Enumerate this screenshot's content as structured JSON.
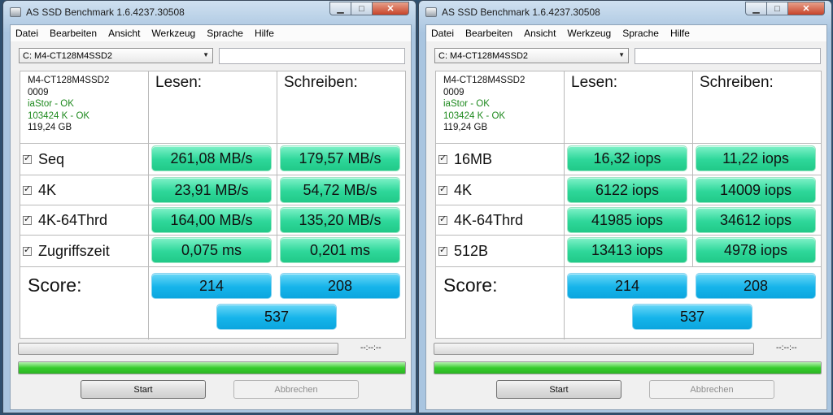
{
  "windows": [
    {
      "title": "AS SSD Benchmark 1.6.4237.30508",
      "menu": [
        "Datei",
        "Bearbeiten",
        "Ansicht",
        "Werkzeug",
        "Sprache",
        "Hilfe"
      ],
      "drive": "C: M4-CT128M4SSD2",
      "info": {
        "model": "M4-CT128M4SSD2",
        "firmware": "0009",
        "driver": "iaStor - OK",
        "alignment": "103424 K - OK",
        "size": "119,24 GB"
      },
      "headers": {
        "read": "Lesen:",
        "write": "Schreiben:"
      },
      "rows": [
        {
          "label": "Seq",
          "read": "261,08 MB/s",
          "write": "179,57 MB/s"
        },
        {
          "label": "4K",
          "read": "23,91 MB/s",
          "write": "54,72 MB/s"
        },
        {
          "label": "4K-64Thrd",
          "read": "164,00 MB/s",
          "write": "135,20 MB/s"
        },
        {
          "label": "Zugriffszeit",
          "read": "0,075 ms",
          "write": "0,201 ms"
        }
      ],
      "score": {
        "label": "Score:",
        "read": "214",
        "write": "208",
        "total": "537"
      },
      "eta": "--:--:--",
      "progress_percent": 100,
      "buttons": {
        "start": "Start",
        "abort": "Abbrechen"
      }
    },
    {
      "title": "AS SSD Benchmark 1.6.4237.30508",
      "menu": [
        "Datei",
        "Bearbeiten",
        "Ansicht",
        "Werkzeug",
        "Sprache",
        "Hilfe"
      ],
      "drive": "C: M4-CT128M4SSD2",
      "info": {
        "model": "M4-CT128M4SSD2",
        "firmware": "0009",
        "driver": "iaStor - OK",
        "alignment": "103424 K - OK",
        "size": "119,24 GB"
      },
      "headers": {
        "read": "Lesen:",
        "write": "Schreiben:"
      },
      "rows": [
        {
          "label": "16MB",
          "read": "16,32 iops",
          "write": "11,22 iops"
        },
        {
          "label": "4K",
          "read": "6122 iops",
          "write": "14009 iops"
        },
        {
          "label": "4K-64Thrd",
          "read": "41985 iops",
          "write": "34612 iops"
        },
        {
          "label": "512B",
          "read": "13413 iops",
          "write": "4978 iops"
        }
      ],
      "score": {
        "label": "Score:",
        "read": "214",
        "write": "208",
        "total": "537"
      },
      "eta": "--:--:--",
      "progress_percent": 100,
      "buttons": {
        "start": "Start",
        "abort": "Abbrechen"
      }
    }
  ],
  "colors": {
    "value_cell": "#2ed79a",
    "score_cell": "#15b4ea",
    "progress_fill": "#35cc2c",
    "ok_text": "#1f8a1f"
  },
  "icons": {
    "titlebar": "drive-icon",
    "minimize": "minimize-icon",
    "maximize": "maximize-icon",
    "close": "close-icon",
    "dropdown": "chevron-down-icon",
    "checkbox": "checkmark-icon"
  }
}
